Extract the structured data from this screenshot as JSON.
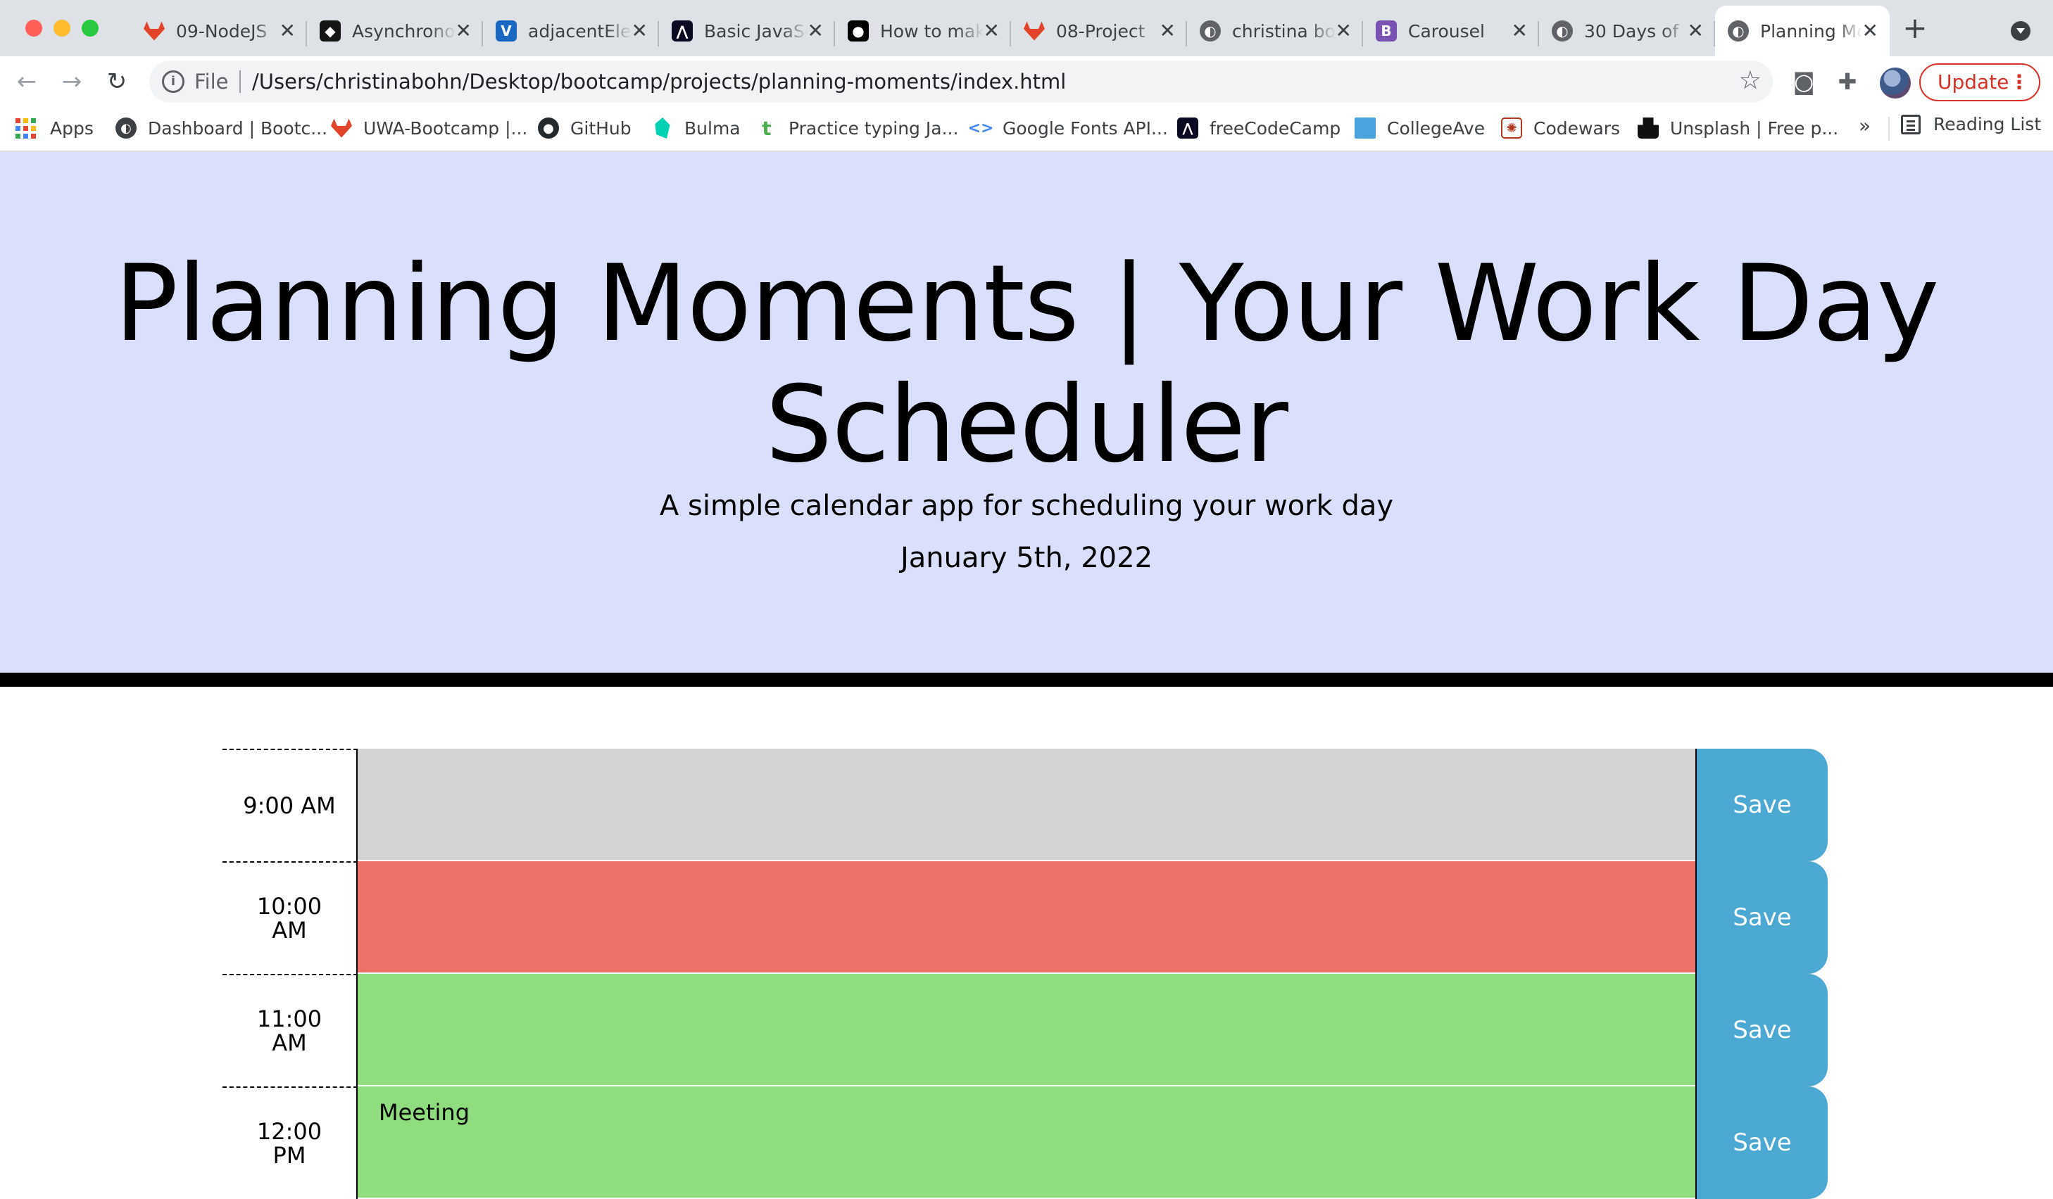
{
  "browser": {
    "tabs": [
      {
        "title": "09-NodeJS",
        "icon": "gitlab-icon",
        "color": "#e24329"
      },
      {
        "title": "Asynchronous",
        "icon": "codesandbox-icon",
        "color": "#151515"
      },
      {
        "title": "adjacentElement",
        "icon": "vuetify-icon",
        "color": "#1867c0"
      },
      {
        "title": "Basic JavaScript",
        "icon": "freecodecamp-icon",
        "color": "#0a0a23"
      },
      {
        "title": "How to make",
        "icon": "medium-icon",
        "color": "#000000"
      },
      {
        "title": "08-Project",
        "icon": "gitlab-icon",
        "color": "#e24329"
      },
      {
        "title": "christina bohn",
        "icon": "globe-icon",
        "color": "#5f6368"
      },
      {
        "title": "Carousel",
        "icon": "bootstrap-icon",
        "color": "#7952b3"
      },
      {
        "title": "30 Days of",
        "icon": "globe-icon",
        "color": "#5f6368"
      },
      {
        "title": "Planning Moments",
        "icon": "globe-icon",
        "color": "#5f6368",
        "active": true
      }
    ],
    "address": {
      "scheme_label": "File",
      "url": "/Users/christinabohn/Desktop/bootcamp/projects/planning-moments/index.html"
    },
    "update_label": "Update",
    "bookmarks": [
      {
        "label": "Apps",
        "icon": "apps-grid-icon"
      },
      {
        "label": "Dashboard | Bootc...",
        "icon": "globe-icon"
      },
      {
        "label": "UWA-Bootcamp |...",
        "icon": "gitlab-icon"
      },
      {
        "label": "GitHub",
        "icon": "github-icon"
      },
      {
        "label": "Bulma",
        "icon": "bulma-icon"
      },
      {
        "label": "Practice typing Ja...",
        "icon": "typing-icon"
      },
      {
        "label": "Google Fonts API...",
        "icon": "google-fonts-icon"
      },
      {
        "label": "freeCodeCamp",
        "icon": "freecodecamp-icon"
      },
      {
        "label": "CollegeAve",
        "icon": "collegeave-icon"
      },
      {
        "label": "Codewars",
        "icon": "codewars-icon"
      },
      {
        "label": "Unsplash | Free p...",
        "icon": "unsplash-icon"
      }
    ],
    "more_label": "»",
    "reading_list_label": "Reading List"
  },
  "header": {
    "title": "Planning Moments | Your Work Day Scheduler",
    "subtitle": "A simple calendar app for scheduling your work day",
    "current_day": "January 5th, 2022"
  },
  "schedule": {
    "save_label": "Save",
    "rows": [
      {
        "hour": "9:00 AM",
        "status": "past",
        "text": ""
      },
      {
        "hour": "10:00 AM",
        "status": "present",
        "text": ""
      },
      {
        "hour": "11:00 AM",
        "status": "future",
        "text": ""
      },
      {
        "hour": "12:00 PM",
        "status": "future",
        "text": "Meeting"
      }
    ]
  },
  "colors": {
    "jumbotron_bg": "#dae0fc",
    "past": "#d3d3d3",
    "present": "#ec7168",
    "future": "#90dd7f",
    "save_button": "#4aa8d3"
  }
}
